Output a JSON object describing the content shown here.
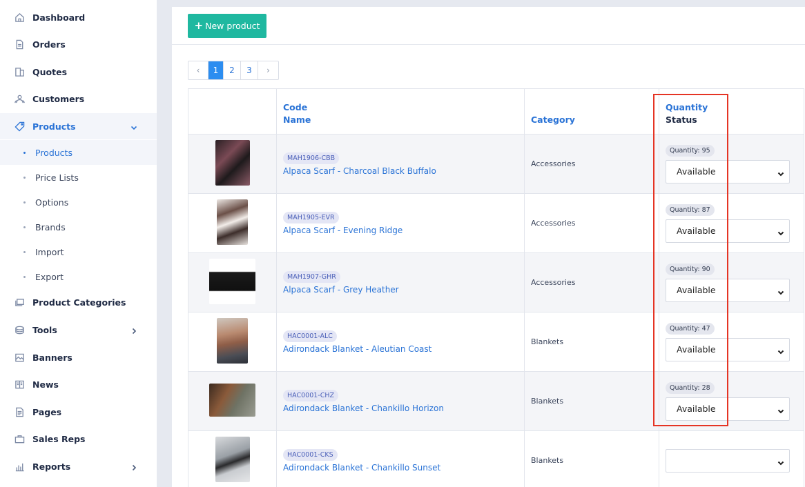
{
  "sidebar": {
    "items": [
      {
        "label": "Dashboard",
        "icon": "home-icon"
      },
      {
        "label": "Orders",
        "icon": "document-icon"
      },
      {
        "label": "Quotes",
        "icon": "quotes-icon"
      },
      {
        "label": "Customers",
        "icon": "users-icon"
      },
      {
        "label": "Products",
        "icon": "tag-icon"
      },
      {
        "label": "Product Categories",
        "icon": "layers-icon"
      },
      {
        "label": "Tools",
        "icon": "tools-icon"
      },
      {
        "label": "Banners",
        "icon": "image-icon"
      },
      {
        "label": "News",
        "icon": "news-icon"
      },
      {
        "label": "Pages",
        "icon": "pages-icon"
      },
      {
        "label": "Sales Reps",
        "icon": "briefcase-icon"
      },
      {
        "label": "Reports",
        "icon": "chart-icon"
      }
    ],
    "products_sub": [
      "Products",
      "Price Lists",
      "Options",
      "Brands",
      "Import",
      "Export"
    ]
  },
  "toolbar": {
    "new_product_label": "New product"
  },
  "pager": {
    "pages": [
      "1",
      "2",
      "3"
    ],
    "prev": "‹",
    "next": "›"
  },
  "table": {
    "headers": {
      "code": "Code",
      "name": "Name",
      "category": "Category",
      "quantity": "Quantity",
      "status": "Status"
    },
    "rows": [
      {
        "code": "MAH1906-CBB",
        "name": "Alpaca Scarf - Charcoal Black Buffalo",
        "category": "Accessories",
        "quantity": "Quantity: 95",
        "status": "Available"
      },
      {
        "code": "MAH1905-EVR",
        "name": "Alpaca Scarf - Evening Ridge",
        "category": "Accessories",
        "quantity": "Quantity: 87",
        "status": "Available"
      },
      {
        "code": "MAH1907-GHR",
        "name": "Alpaca Scarf - Grey Heather",
        "category": "Accessories",
        "quantity": "Quantity: 90",
        "status": "Available"
      },
      {
        "code": "HAC0001-ALC",
        "name": "Adirondack Blanket - Aleutian Coast",
        "category": "Blankets",
        "quantity": "Quantity: 47",
        "status": "Available"
      },
      {
        "code": "HAC0001-CHZ",
        "name": "Adirondack Blanket - Chankillo Horizon",
        "category": "Blankets",
        "quantity": "Quantity: 28",
        "status": "Available"
      },
      {
        "code": "HAC0001-CKS",
        "name": "Adirondack Blanket - Chankillo Sunset",
        "category": "Blankets",
        "quantity": "",
        "status": ""
      }
    ]
  },
  "colors": {
    "accent": "#2a73d6",
    "new_button": "#1fb8a0",
    "highlight": "#e53424"
  }
}
